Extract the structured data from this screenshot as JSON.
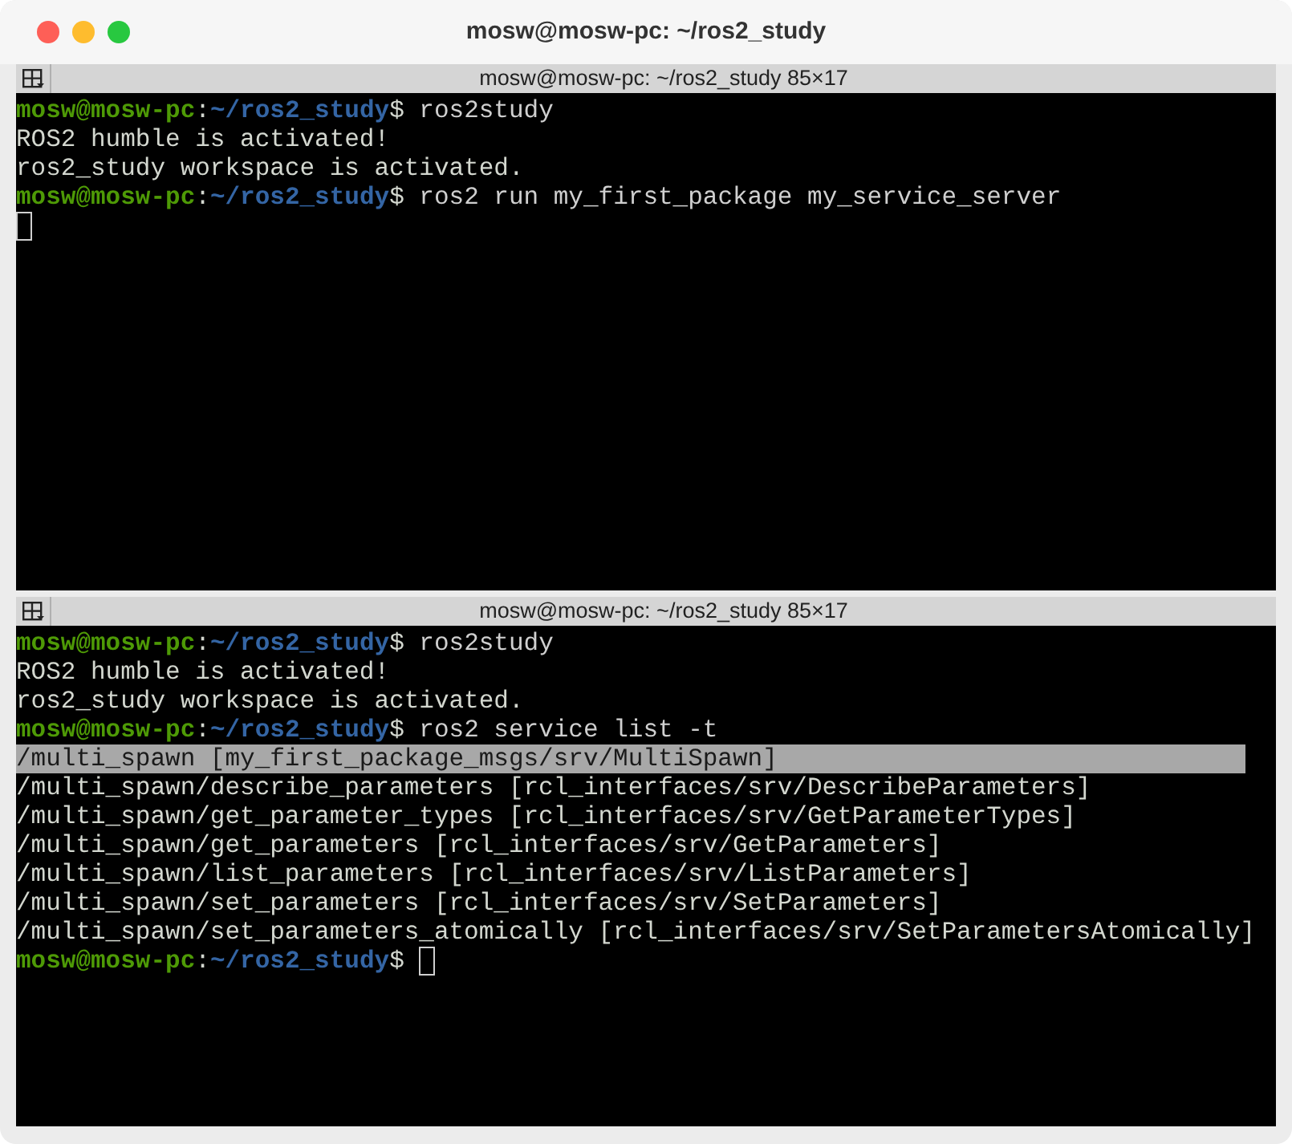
{
  "window": {
    "title": "mosw@mosw-pc: ~/ros2_study"
  },
  "panes": [
    {
      "title": "mosw@mosw-pc: ~/ros2_study 85×17",
      "lines": [
        {
          "kind": "prompt",
          "user": "mosw@mosw-pc",
          "sep": ":",
          "path": "~/ros2_study",
          "symbol": "$",
          "command": "ros2study"
        },
        {
          "kind": "output",
          "text": "ROS2 humble is activated!",
          "selected": false
        },
        {
          "kind": "output",
          "text": "ros2_study workspace is activated.",
          "selected": false
        },
        {
          "kind": "prompt",
          "user": "mosw@mosw-pc",
          "sep": ":",
          "path": "~/ros2_study",
          "symbol": "$",
          "command": "ros2 run my_first_package my_service_server"
        },
        {
          "kind": "cursor"
        }
      ]
    },
    {
      "title": "mosw@mosw-pc: ~/ros2_study 85×17",
      "lines": [
        {
          "kind": "prompt",
          "user": "mosw@mosw-pc",
          "sep": ":",
          "path": "~/ros2_study",
          "symbol": "$",
          "command": "ros2study"
        },
        {
          "kind": "output",
          "text": "ROS2 humble is activated!",
          "selected": false
        },
        {
          "kind": "output",
          "text": "ros2_study workspace is activated.",
          "selected": false
        },
        {
          "kind": "prompt",
          "user": "mosw@mosw-pc",
          "sep": ":",
          "path": "~/ros2_study",
          "symbol": "$",
          "command": "ros2 service list -t"
        },
        {
          "kind": "output",
          "text": "/multi_spawn [my_first_package_msgs/srv/MultiSpawn]",
          "selected": true
        },
        {
          "kind": "output",
          "text": "/multi_spawn/describe_parameters [rcl_interfaces/srv/DescribeParameters]",
          "selected": false
        },
        {
          "kind": "output",
          "text": "/multi_spawn/get_parameter_types [rcl_interfaces/srv/GetParameterTypes]",
          "selected": false
        },
        {
          "kind": "output",
          "text": "/multi_spawn/get_parameters [rcl_interfaces/srv/GetParameters]",
          "selected": false
        },
        {
          "kind": "output",
          "text": "/multi_spawn/list_parameters [rcl_interfaces/srv/ListParameters]",
          "selected": false
        },
        {
          "kind": "output",
          "text": "/multi_spawn/set_parameters [rcl_interfaces/srv/SetParameters]",
          "selected": false
        },
        {
          "kind": "output",
          "text": "/multi_spawn/set_parameters_atomically [rcl_interfaces/srv/SetParametersAtomically]",
          "selected": false
        },
        {
          "kind": "active_prompt",
          "user": "mosw@mosw-pc",
          "sep": ":",
          "path": "~/ros2_study",
          "symbol": "$"
        }
      ]
    }
  ]
}
